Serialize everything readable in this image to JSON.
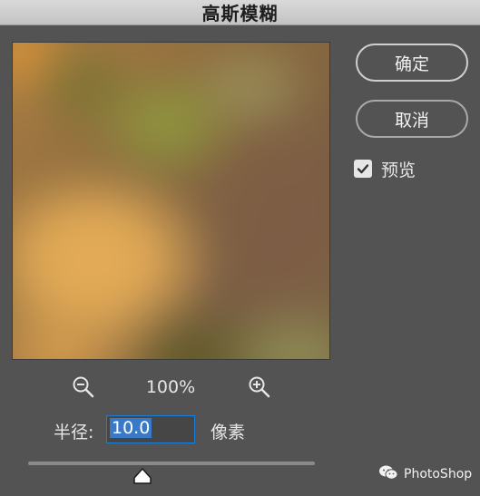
{
  "window": {
    "title": "高斯模糊"
  },
  "buttons": {
    "ok_label": "确定",
    "cancel_label": "取消"
  },
  "preview_toggle": {
    "label": "预览",
    "checked": true
  },
  "zoom": {
    "level": "100%"
  },
  "radius": {
    "label": "半径:",
    "value": "10.0",
    "unit": "像素"
  },
  "slider": {
    "value_fraction": 0.4
  },
  "watermark": {
    "text": "PhotoShop"
  },
  "icons": {
    "zoom_out": "zoom-out-icon",
    "zoom_in": "zoom-in-icon",
    "check": "check-icon",
    "wechat": "wechat-icon"
  },
  "colors": {
    "background": "#535353",
    "accent": "#1c7fd6",
    "selection": "#3a79c8"
  }
}
